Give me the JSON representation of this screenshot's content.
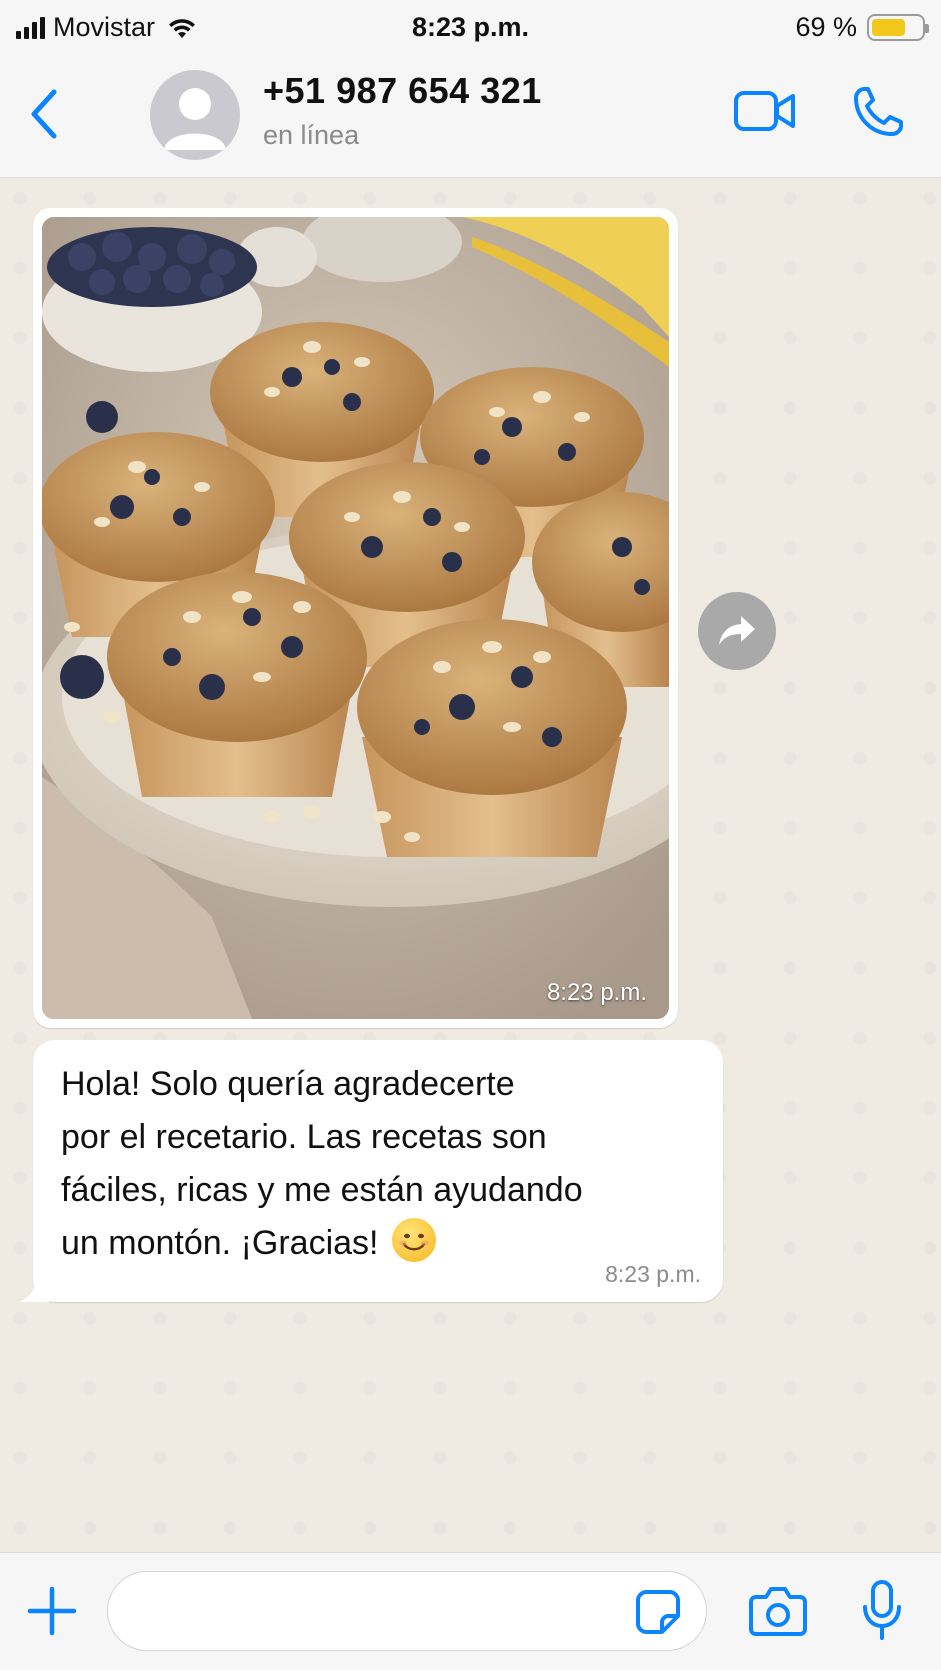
{
  "status_bar": {
    "carrier": "Movistar",
    "time": "8:23 p.m.",
    "battery_percent": "69 %",
    "battery_level": 0.69,
    "icons": [
      "signal-icon",
      "wifi-icon",
      "battery-icon"
    ]
  },
  "header": {
    "contact_name": "+51 987 654 321",
    "contact_status": "en línea",
    "icons": [
      "back-chevron-icon",
      "avatar-icon",
      "video-call-icon",
      "phone-call-icon"
    ]
  },
  "chat": {
    "image_message": {
      "time": "8:23 p.m."
    },
    "text_message": {
      "line1": "Hola! Solo quería agradecerte",
      "line2": "por el recetario. Las recetas son",
      "line3": "fáciles, ricas y me están ayudando",
      "line4": "un montón. ¡Gracias! ",
      "time": "8:23 p.m."
    }
  },
  "input_bar": {
    "placeholder": "",
    "icons": [
      "plus-icon",
      "sticker-icon",
      "camera-icon",
      "microphone-icon"
    ]
  },
  "colors": {
    "accent": "#0a84ff",
    "chat_background": "#efeae2",
    "bubble": "#ffffff",
    "battery": "#f2c81a"
  }
}
